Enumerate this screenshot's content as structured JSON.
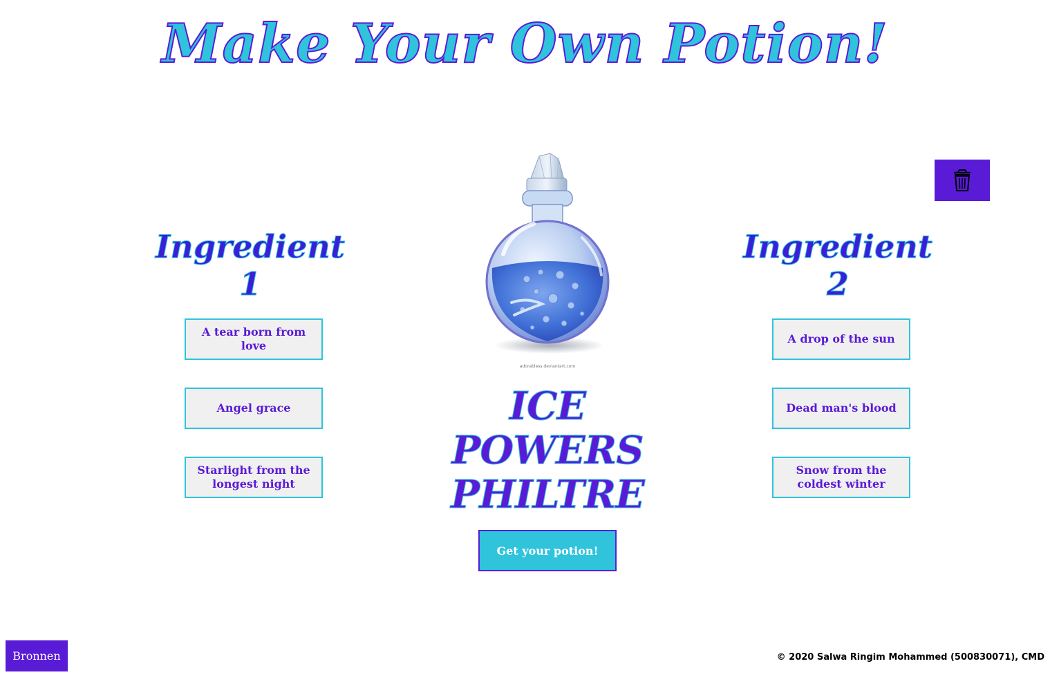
{
  "header": {
    "title": "Make Your Own Potion!"
  },
  "ingredients_left": {
    "heading": "Ingredient 1",
    "items": [
      "A tear born from love",
      "Angel grace",
      "Starlight from the longest night"
    ]
  },
  "ingredients_right": {
    "heading": "Ingredient 2",
    "items": [
      "A drop of the sun",
      "Dead man's blood",
      "Snow from the coldest winter"
    ]
  },
  "potion": {
    "image_credit": "adorabless.deviantart.com",
    "result_name": "ICE POWERS PHILTRE",
    "liquid_color": "#3f6fd6"
  },
  "actions": {
    "get_potion_label": "Get your potion!",
    "trash_icon": "trash-icon"
  },
  "footer": {
    "sources_label": "Bronnen",
    "copyright": "© 2020 Salwa Ringim Mohammed (500830071), CMD"
  },
  "colors": {
    "purple": "#5a1bd6",
    "cyan": "#2fc3dc",
    "button_bg": "#f0f0f0"
  }
}
